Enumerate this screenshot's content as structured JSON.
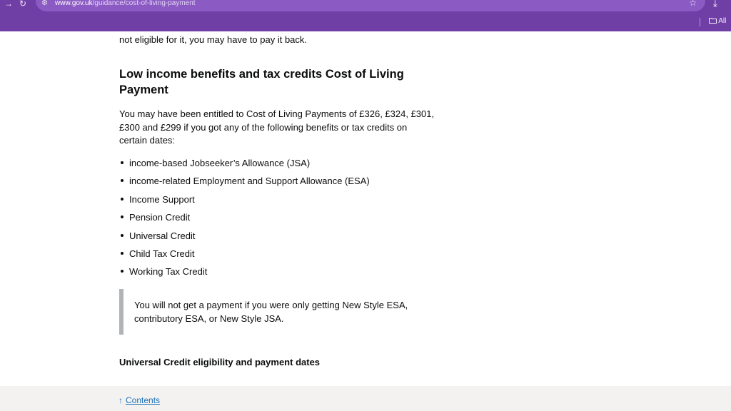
{
  "browser": {
    "back_icon": "arrow-right-icon",
    "back_glyph": "→",
    "reload_icon": "reload-icon",
    "reload_glyph": "↻",
    "site_icon": "tune-icon",
    "site_glyph": "⚙",
    "url_host": "www.gov.uk",
    "url_path": "/guidance/cost-of-living-payment",
    "star_glyph": "☆",
    "download_glyph": "⤓",
    "bookmarks_label": "All",
    "theme_color": "#6f3fa6"
  },
  "page": {
    "intro_text": "not eligible for it, you may have to pay it back.",
    "heading": "Low income benefits and tax credits Cost of Living Payment",
    "paragraph_lines": [
      "You may have been entitled to Cost of Living Payments of £326, £324, £301,",
      "£300 and £299 if you got any of the following benefits or tax credits on",
      "certain dates:"
    ],
    "benefits": [
      "income-based Jobseeker’s Allowance (JSA)",
      "income-related Employment and Support Allowance (ESA)",
      "Income Support",
      "Pension Credit",
      "Universal Credit",
      "Child Tax Credit",
      "Working Tax Credit"
    ],
    "inset_lines": [
      "You will not get a payment if you were only getting New Style ESA,",
      "contributory ESA, or New Style JSA."
    ],
    "subheading": "Universal Credit eligibility and payment dates"
  },
  "footer": {
    "arrow_glyph": "↑",
    "contents_label": "Contents",
    "link_color": "#1d70b8"
  }
}
